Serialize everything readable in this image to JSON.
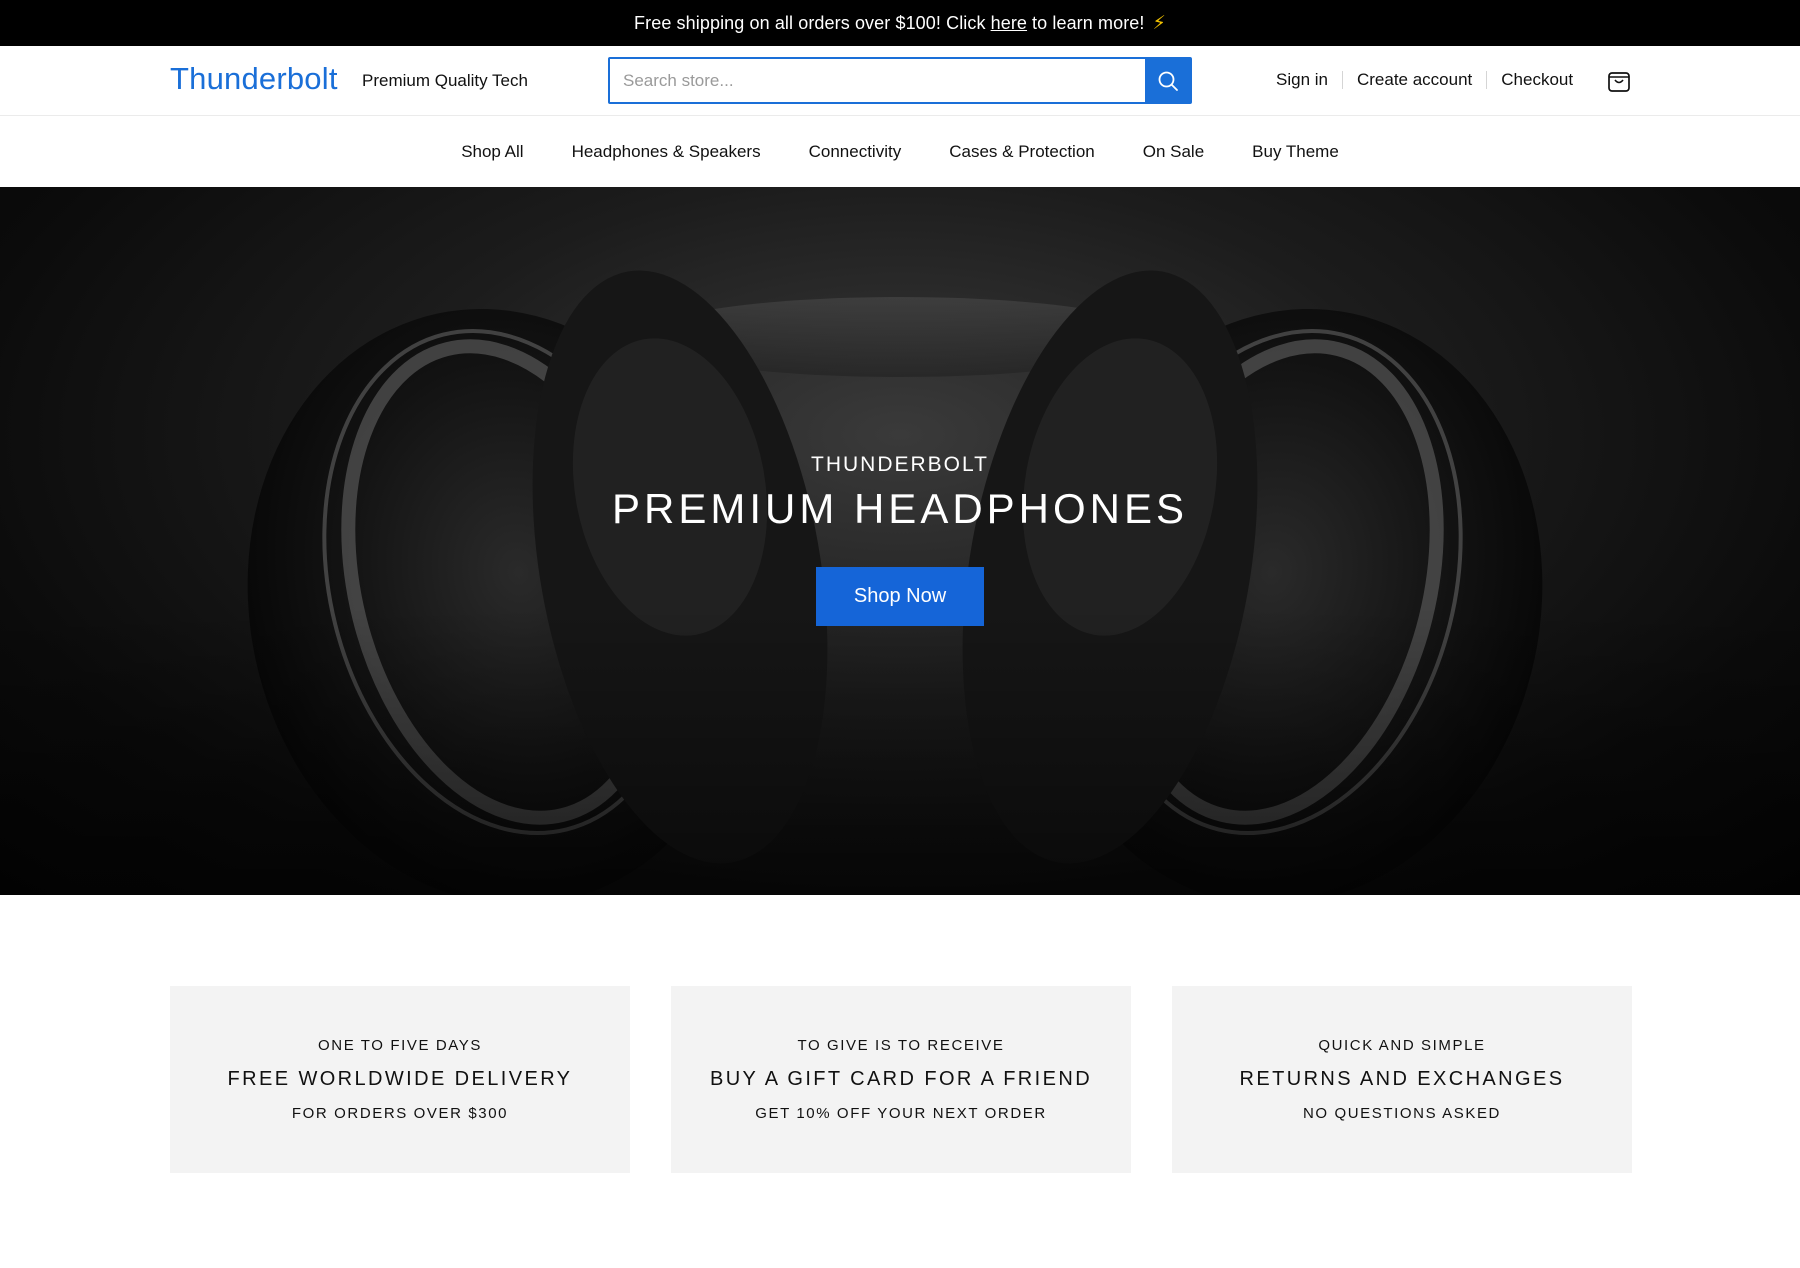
{
  "announcement": {
    "before_link": "Free shipping on all orders over $100! Click",
    "link": "here",
    "after_link": "to learn more!",
    "emoji": "⚡"
  },
  "header": {
    "logo": "Thunderbolt",
    "tagline": "Premium Quality Tech",
    "search_placeholder": "Search store...",
    "account_links": [
      "Sign in",
      "Create account",
      "Checkout"
    ],
    "brand_color": "#1a6fd8"
  },
  "nav": {
    "items": [
      "Shop All",
      "Headphones & Speakers",
      "Connectivity",
      "Cases & Protection",
      "On Sale",
      "Buy Theme"
    ]
  },
  "hero": {
    "subtitle": "THUNDERBOLT",
    "title": "PREMIUM HEADPHONES",
    "cta": "Shop Now",
    "cta_color": "#1565d8"
  },
  "features": [
    {
      "kicker": "ONE TO FIVE DAYS",
      "heading": "FREE WORLDWIDE DELIVERY",
      "detail": "FOR ORDERS OVER $300"
    },
    {
      "kicker": "TO GIVE IS TO RECEIVE",
      "heading": "BUY A GIFT CARD FOR A FRIEND",
      "detail": "GET 10% OFF YOUR NEXT ORDER"
    },
    {
      "kicker": "QUICK AND SIMPLE",
      "heading": "RETURNS AND EXCHANGES",
      "detail": "NO QUESTIONS ASKED"
    }
  ]
}
